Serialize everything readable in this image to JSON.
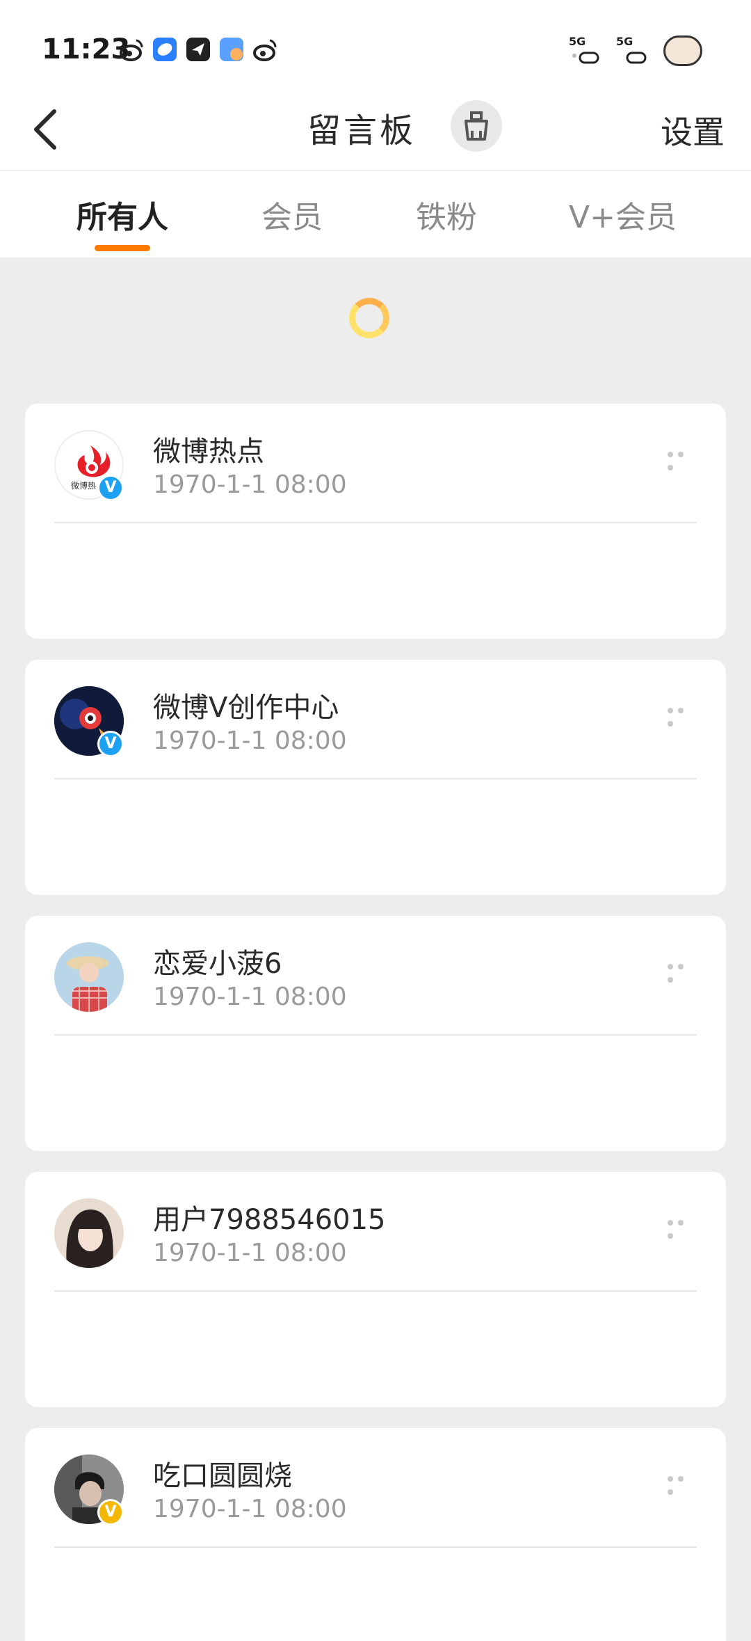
{
  "status_bar": {
    "time": "11:23",
    "net1": "5G",
    "net2": "5G"
  },
  "nav": {
    "title": "留言板",
    "settings_label": "设置"
  },
  "tabs": [
    {
      "label": "所有人",
      "active": true
    },
    {
      "label": "会员",
      "active": false
    },
    {
      "label": "铁粉",
      "active": false
    },
    {
      "label": "V+会员",
      "active": false
    }
  ],
  "messages": [
    {
      "name": "微博热点",
      "date": "1970-1-1 08:00",
      "badge": "V",
      "badge_color": "#1da1f2",
      "avatar_caption": "微博热"
    },
    {
      "name": "微博V创作中心",
      "date": "1970-1-1 08:00",
      "badge": "V",
      "badge_color": "#1da1f2"
    },
    {
      "name": "恋爱小菠6",
      "date": "1970-1-1 08:00",
      "badge": ""
    },
    {
      "name": "用户7988546015",
      "date": "1970-1-1 08:00",
      "badge": ""
    },
    {
      "name": "吃口圆圆烧",
      "date": "1970-1-1 08:00",
      "badge": "V",
      "badge_color": "#f5b800"
    }
  ],
  "colors": {
    "accent": "#ff7a00",
    "background": "#ededed",
    "verified_blue": "#1da1f2",
    "verified_gold": "#f5b800"
  }
}
